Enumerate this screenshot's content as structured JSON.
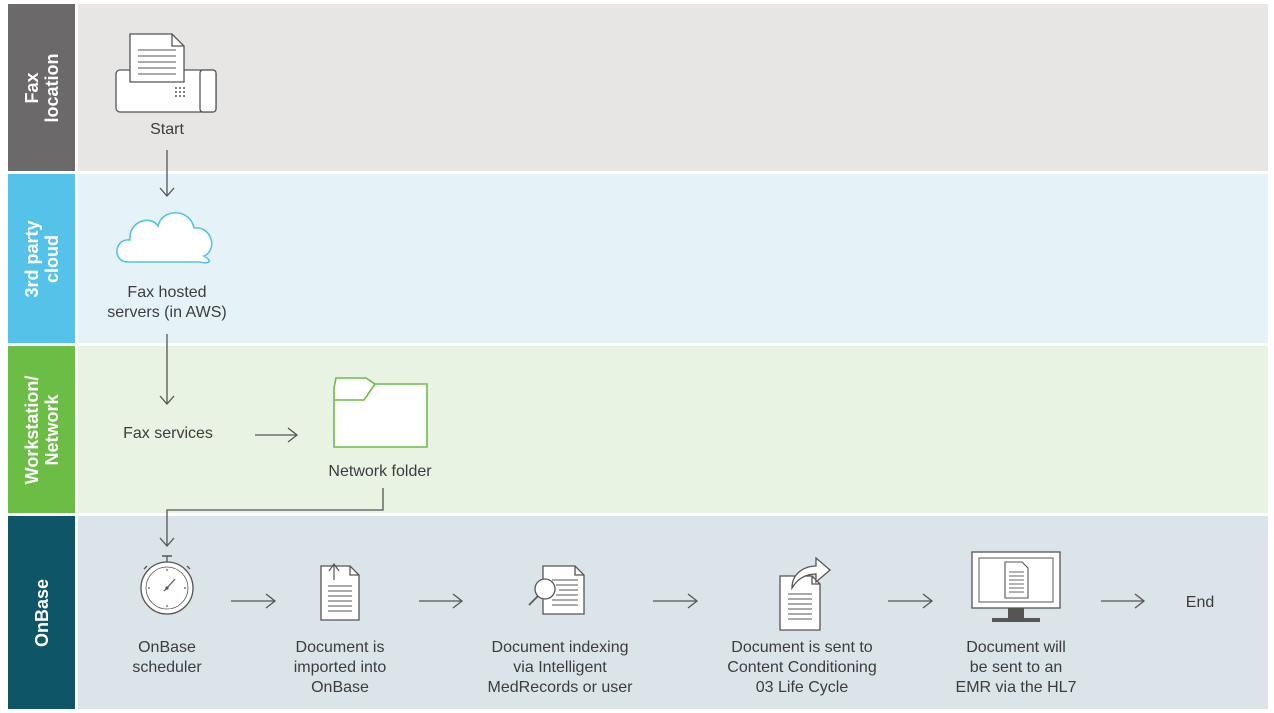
{
  "lanes": [
    {
      "label": "Fax\nlocation",
      "tab_color": "#6b6969",
      "bg_color": "#e8e6e4"
    },
    {
      "label": "3rd party\ncloud",
      "tab_color": "#54c2e9",
      "bg_color": "#e5f3f9"
    },
    {
      "label": "Workstation/\nNetwork",
      "tab_color": "#6cbd45",
      "bg_color": "#e8f3e3"
    },
    {
      "label": "OnBase",
      "tab_color": "#0e5567",
      "bg_color": "#dbe4e8"
    }
  ],
  "steps": {
    "start": "Start",
    "fax_hosted": "Fax hosted\nservers (in AWS)",
    "fax_services": "Fax services",
    "network_folder": "Network folder",
    "scheduler": "OnBase\nscheduler",
    "imported": "Document is\nimported into\nOnBase",
    "indexing": "Document indexing\nvia Intelligent\nMedRecords or user",
    "conditioning": "Document is sent to\nContent Conditioning\n03 Life Cycle",
    "emr": "Document will\nbe sent to an\nEMR via the HL7",
    "end": "End"
  },
  "colors": {
    "folder_green": "#6cbd45",
    "cloud_blue": "#54c2e9",
    "arrow": "#555555"
  }
}
